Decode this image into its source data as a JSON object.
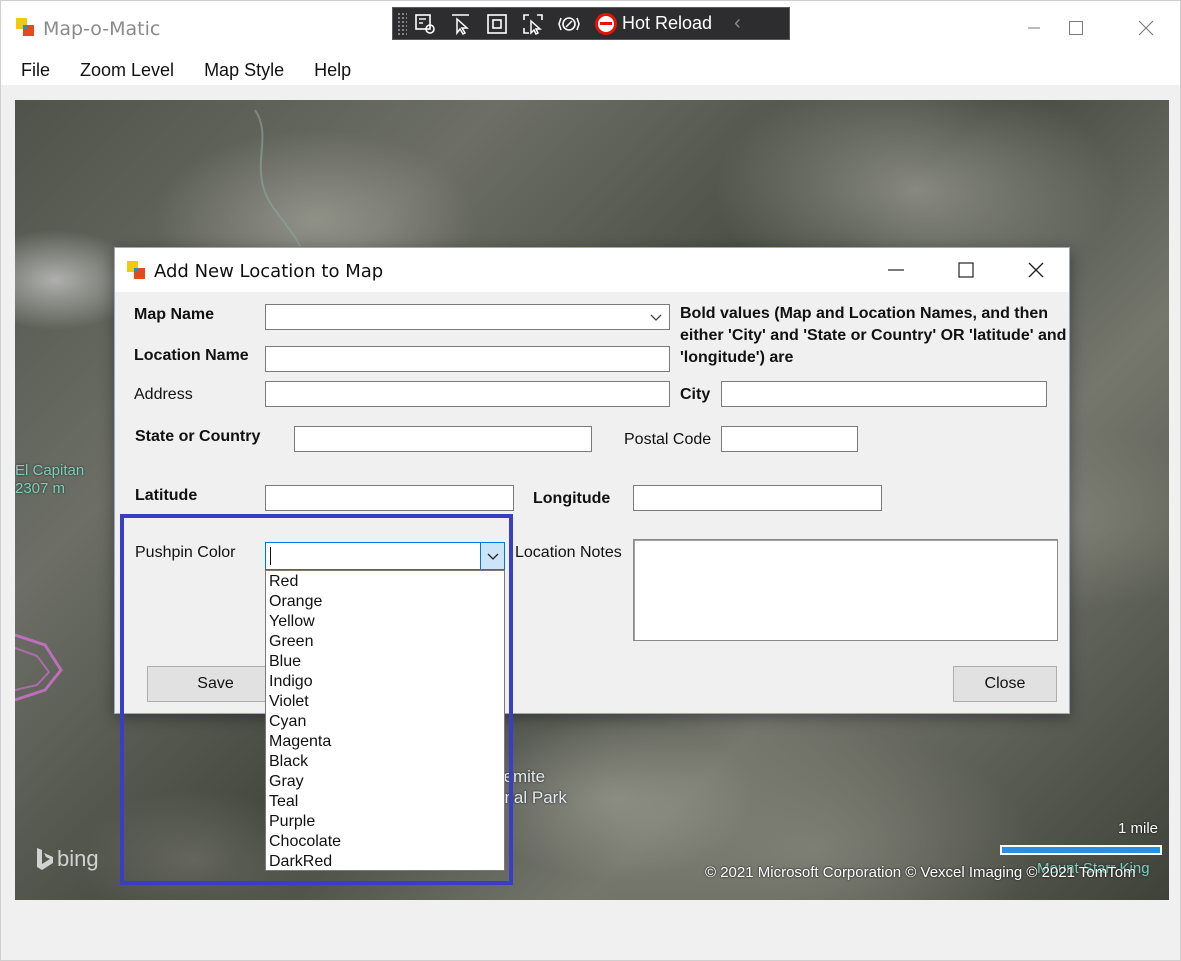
{
  "app": {
    "title": "Map-o-Matic"
  },
  "devtoolbar": {
    "hot_reload_label": "Hot Reload"
  },
  "menu": {
    "items": [
      "File",
      "Zoom Level",
      "Map Style",
      "Help"
    ]
  },
  "map": {
    "labels": {
      "el_capitan_name": "El Capitan",
      "el_capitan_elev": "2307 m",
      "park_line1": "semite",
      "park_line2": "onal Park",
      "mount_starr_king": "Mount Starr King"
    },
    "scale_label": "1 mile",
    "copyright": "© 2021 Microsoft Corporation   © Vexcel Imaging   © 2021 TomTom",
    "provider": "bing"
  },
  "dialog": {
    "title": "Add New Location to Map",
    "labels": {
      "map_name": "Map Name",
      "location_name": "Location Name",
      "address": "Address",
      "city": "City",
      "state_or_country": "State or Country",
      "postal_code": "Postal Code",
      "latitude": "Latitude",
      "longitude": "Longitude",
      "pushpin_color": "Pushpin Color",
      "location_notes": "Location Notes"
    },
    "note": "Bold values (Map and Location Names, and then either 'City' and 'State or Country' OR 'latitude' and 'longitude') are",
    "fields": {
      "map_name": "",
      "location_name": "",
      "address": "",
      "city": "",
      "state_or_country": "",
      "postal_code": "",
      "latitude": "",
      "longitude": "",
      "pushpin_color": "",
      "location_notes": ""
    },
    "pushpin_options": [
      "Red",
      "Orange",
      "Yellow",
      "Green",
      "Blue",
      "Indigo",
      "Violet",
      "Cyan",
      "Magenta",
      "Black",
      "Gray",
      "Teal",
      "Purple",
      "Chocolate",
      "DarkRed"
    ],
    "buttons": {
      "save": "Save",
      "close": "Close"
    }
  }
}
